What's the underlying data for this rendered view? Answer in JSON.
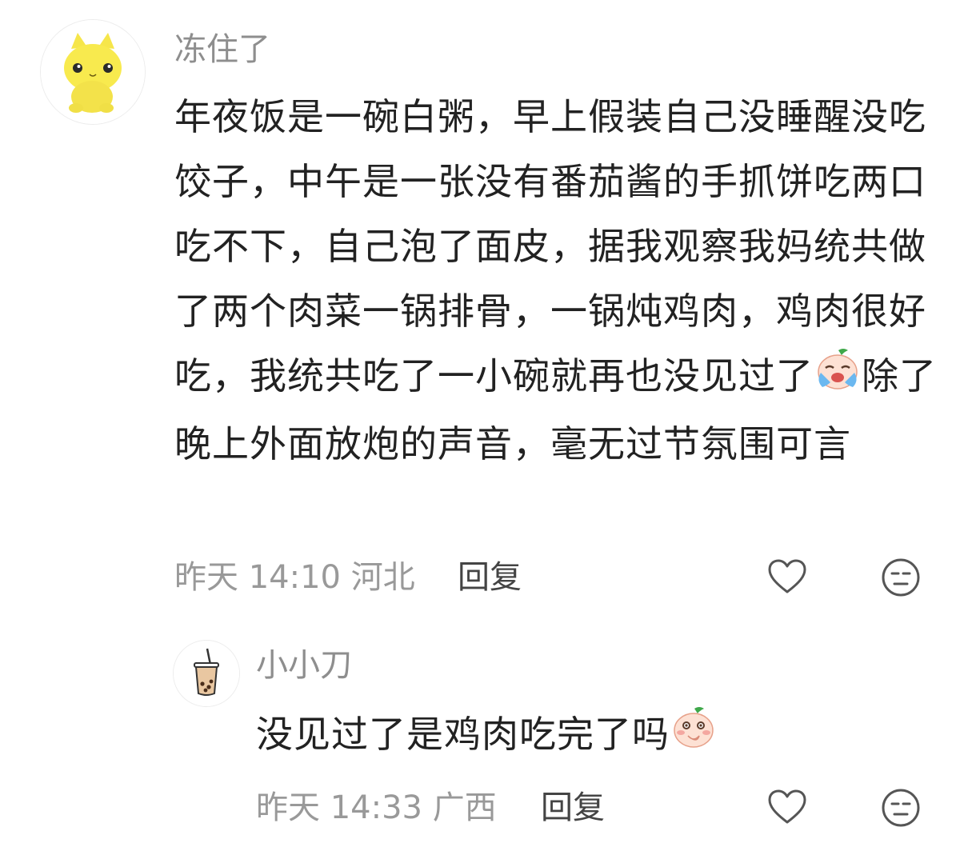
{
  "comment": {
    "username": "冻住了",
    "text_before_emoji": "年夜饭是一碗白粥，早上假装自己没睡醒没吃饺子，中午是一张没有番茄酱的手抓饼吃两口吃不下，自己泡了面皮，据我观察我妈统共做了两个肉菜一锅排骨，一锅炖鸡肉，鸡肉很好吃，我统共吃了一小碗就再也没见过了",
    "emoji": "crying-peach-emoji",
    "text_after_emoji": "除了晚上外面放炮的声音，毫无过节氛围可言",
    "time": "昨天 14:10",
    "location": "河北",
    "reply_label": "回复",
    "avatar": "yellow-cat-avatar"
  },
  "reply": {
    "username": "小小刀",
    "text": "没见过了是鸡肉吃完了吗",
    "emoji": "shy-peach-emoji",
    "time": "昨天 14:33",
    "location": "广西",
    "reply_label": "回复",
    "avatar": "bubble-tea-avatar"
  },
  "colors": {
    "username": "#8e8e8e",
    "meta": "#999999",
    "body": "#222222",
    "icon": "#555555"
  }
}
